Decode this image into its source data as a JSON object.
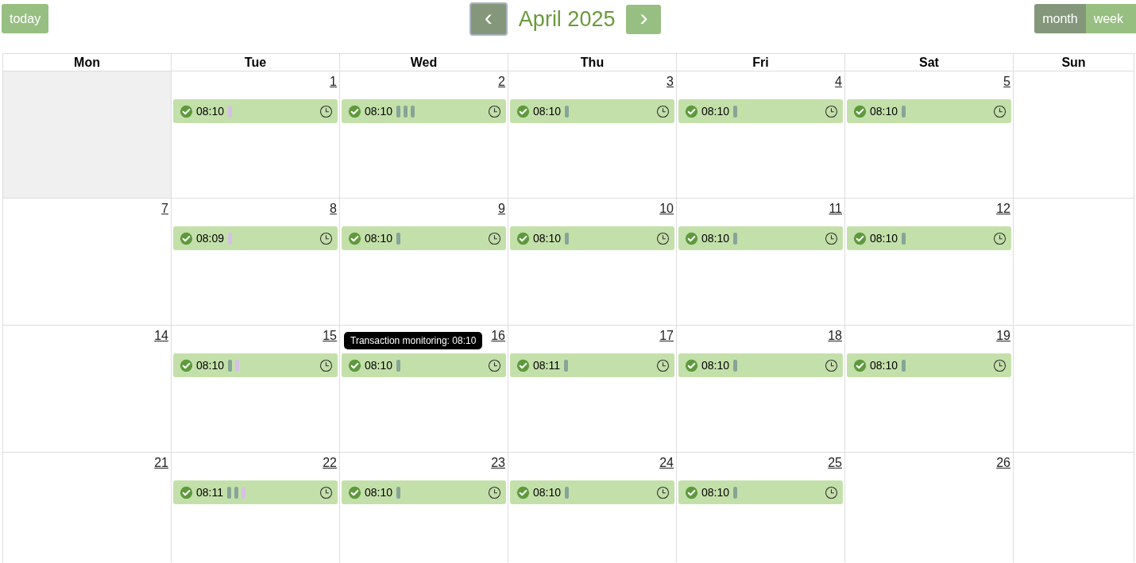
{
  "toolbar": {
    "today_button": "today",
    "title": "April 2025",
    "prev_button": {
      "label": "‹",
      "selected": true
    },
    "next_button": {
      "label": "›",
      "selected": false
    },
    "views": [
      {
        "label": "month",
        "selected": true
      },
      {
        "label": "week",
        "selected": false
      }
    ]
  },
  "weekdays": [
    "Mon",
    "Tue",
    "Wed",
    "Thu",
    "Fri",
    "Sat",
    "Sun"
  ],
  "weeks": [
    [
      {
        "outside": true
      },
      {
        "date": "1",
        "event": {
          "time": "08:10",
          "marks": [
            {
              "color": "#d7bfe6"
            }
          ]
        }
      },
      {
        "date": "2",
        "event": {
          "time": "08:10",
          "marks": [
            {
              "color": "#86a597"
            },
            {
              "color": "#86a597"
            },
            {
              "color": "#86a597"
            }
          ]
        }
      },
      {
        "date": "3",
        "event": {
          "time": "08:10",
          "marks": [
            {
              "color": "#86a597"
            }
          ]
        }
      },
      {
        "date": "4",
        "event": {
          "time": "08:10",
          "marks": [
            {
              "color": "#86a597"
            }
          ]
        }
      },
      {
        "date": "5",
        "event": {
          "time": "08:10",
          "marks": [
            {
              "color": "#86a597"
            }
          ]
        }
      }
    ],
    [
      {
        "date": "7"
      },
      {
        "date": "8",
        "event": {
          "time": "08:09",
          "marks": [
            {
              "color": "#d7bfe6"
            }
          ]
        }
      },
      {
        "date": "9",
        "event": {
          "time": "08:10",
          "marks": [
            {
              "color": "#86a597"
            }
          ]
        }
      },
      {
        "date": "10",
        "event": {
          "time": "08:10",
          "marks": [
            {
              "color": "#86a597"
            }
          ]
        }
      },
      {
        "date": "11",
        "event": {
          "time": "08:10",
          "marks": [
            {
              "color": "#86a597"
            }
          ]
        }
      },
      {
        "date": "12",
        "event": {
          "time": "08:10",
          "marks": [
            {
              "color": "#86a597"
            }
          ]
        }
      }
    ],
    [
      {
        "date": "14"
      },
      {
        "date": "15",
        "event": {
          "time": "08:10",
          "marks": [
            {
              "color": "#86a597"
            },
            {
              "color": "#d7bfe6"
            }
          ]
        }
      },
      {
        "date": "16",
        "event": {
          "time": "08:10",
          "marks": [
            {
              "color": "#86a597"
            }
          ],
          "tooltip": "Transaction monitoring: 08:10"
        }
      },
      {
        "date": "17",
        "event": {
          "time": "08:11",
          "marks": [
            {
              "color": "#86a597"
            }
          ]
        }
      },
      {
        "date": "18",
        "event": {
          "time": "08:10",
          "marks": [
            {
              "color": "#86a597"
            }
          ]
        }
      },
      {
        "date": "19",
        "event": {
          "time": "08:10",
          "marks": [
            {
              "color": "#86a597"
            }
          ]
        }
      }
    ],
    [
      {
        "date": "21"
      },
      {
        "date": "22",
        "event": {
          "time": "08:11",
          "marks": [
            {
              "color": "#86a597"
            },
            {
              "color": "#86a597"
            },
            {
              "color": "#d7bfe6"
            }
          ]
        }
      },
      {
        "date": "23",
        "event": {
          "time": "08:10",
          "marks": [
            {
              "color": "#86a597"
            }
          ]
        }
      },
      {
        "date": "24",
        "event": {
          "time": "08:10",
          "marks": [
            {
              "color": "#86a597"
            }
          ]
        }
      },
      {
        "date": "25",
        "event": {
          "time": "08:10",
          "marks": [
            {
              "color": "#86a597"
            }
          ]
        }
      },
      {
        "date": "26"
      }
    ]
  ]
}
